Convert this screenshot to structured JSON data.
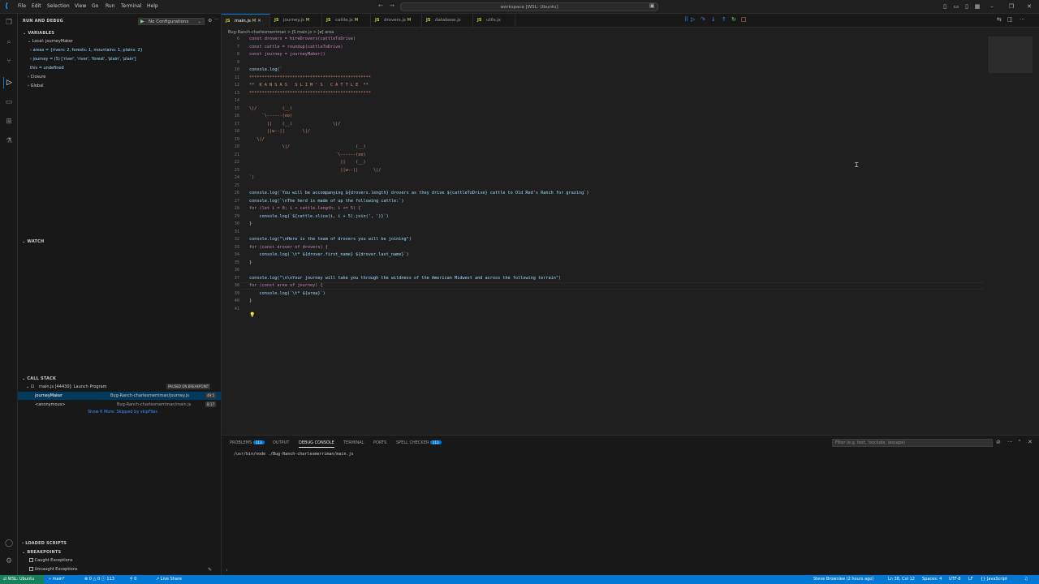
{
  "titlebar": {
    "menu": [
      "File",
      "Edit",
      "Selection",
      "View",
      "Go",
      "Run",
      "Terminal",
      "Help"
    ],
    "search": "workspace [WSL: Ubuntu]"
  },
  "sidebar": {
    "run_debug_title": "RUN AND DEBUG",
    "debug_config": "No Configurations",
    "variables_title": "VARIABLES",
    "local_scope": "Local: journeyMaker",
    "vars": [
      "› areas = {rivers: 2, forests: 1, mountains: 1, plains: 2}",
      "› journey = (5) ['river', 'river', 'forest', 'plain', 'plain']",
      "  this = undefined"
    ],
    "scopes": [
      "Closure",
      "Global"
    ],
    "watch_title": "WATCH",
    "callstack_title": "CALL STACK",
    "callstack_session": "main.js [44430]: Launch Program",
    "paused_label": "PAUSED ON BREAKPOINT",
    "frames": [
      {
        "name": "journeyMaker",
        "file": "Bug-Ranch-charlesmerriman/journey.js",
        "line": "49:5"
      },
      {
        "name": "<anonymous>",
        "file": "Bug-Ranch-charlesmerriman/main.js",
        "line": "8:17"
      }
    ],
    "show_more": "Show 6 More: Skipped by skipFiles",
    "loaded_scripts_title": "LOADED SCRIPTS",
    "breakpoints_title": "BREAKPOINTS",
    "breakpoints": [
      "Caught Exceptions",
      "Uncaught Exceptions"
    ]
  },
  "tabs": [
    {
      "label": "main.js",
      "mod": "M",
      "active": true
    },
    {
      "label": "journey.js",
      "mod": "M",
      "active": false
    },
    {
      "label": "cattle.js",
      "mod": "M",
      "active": false
    },
    {
      "label": "drovers.js",
      "mod": "M",
      "active": false
    },
    {
      "label": "database.js",
      "mod": "",
      "active": false
    },
    {
      "label": "utils.js",
      "mod": "",
      "active": false
    }
  ],
  "breadcrumb": "Bug-Ranch-charlesmerriman  >  JS main.js  >  [ø] area",
  "code_lines": [
    {
      "n": "6",
      "t": "const drovers = hireDrovers(cattleToDrive)"
    },
    {
      "n": "7",
      "t": "const cattle = roundup(cattleToDrive)"
    },
    {
      "n": "8",
      "t": "const journey = journeyMaker()"
    },
    {
      "n": "9",
      "t": ""
    },
    {
      "n": "10",
      "t": "console.log(`"
    },
    {
      "n": "11",
      "t": "************************************************"
    },
    {
      "n": "12",
      "t": "**  K A N S A S   S L I M ' S   C A T T L E  **"
    },
    {
      "n": "13",
      "t": "************************************************"
    },
    {
      "n": "14",
      "t": ""
    },
    {
      "n": "15",
      "t": "\\|/          (__)"
    },
    {
      "n": "16",
      "t": "     `\\------(oo)"
    },
    {
      "n": "17",
      "t": "       ||    (__)                \\|/"
    },
    {
      "n": "18",
      "t": "       ||w--||       \\|/"
    },
    {
      "n": "19",
      "t": "   \\|/"
    },
    {
      "n": "20",
      "t": "             \\|/                          (__)"
    },
    {
      "n": "21",
      "t": "                                  `\\------(oo)"
    },
    {
      "n": "22",
      "t": "                                    ||    (__)"
    },
    {
      "n": "23",
      "t": "                                    ||w--||      \\|/"
    },
    {
      "n": "24",
      "t": "`)"
    },
    {
      "n": "25",
      "t": ""
    },
    {
      "n": "26",
      "t": "console.log(`You will be accompanying ${drovers.length} drovers as they drive ${cattleToDrive} cattle to Old Red's Ranch for grazing`)"
    },
    {
      "n": "27",
      "t": "console.log(`\\nThe herd is made of up the following cattle:`)"
    },
    {
      "n": "28",
      "t": "for (let i = 0; i < cattle.length; i += 5) {"
    },
    {
      "n": "29",
      "t": "    console.log(`${cattle.slice(i, i + 5).join(', ')}`)"
    },
    {
      "n": "30",
      "t": "}"
    },
    {
      "n": "31",
      "t": ""
    },
    {
      "n": "32",
      "t": "console.log(\"\\nHere is the team of drovers you will be joining\")"
    },
    {
      "n": "33",
      "t": "for (const drover of drovers) {"
    },
    {
      "n": "34",
      "t": "    console.log(`\\t* ${drover.first_name} ${drover.last_name}`)"
    },
    {
      "n": "35",
      "t": "}"
    },
    {
      "n": "36",
      "t": ""
    },
    {
      "n": "37",
      "t": "console.log(\"\\n\\nYour journey will take you through the wildness of the American Midwest and across the following terrain\")"
    },
    {
      "n": "38",
      "t": "for (const area of journey) {"
    },
    {
      "n": "39",
      "t": "    console.log(`\\t* ${area}`)"
    },
    {
      "n": "40",
      "t": "}"
    },
    {
      "n": "41",
      "t": ""
    }
  ],
  "panel": {
    "tabs": [
      "PROBLEMS",
      "OUTPUT",
      "DEBUG CONSOLE",
      "TERMINAL",
      "PORTS",
      "SPELL CHECKER"
    ],
    "problems_count": "113",
    "spell_count": "113",
    "filter_placeholder": "Filter (e.g. text, !exclude, \\escape)",
    "console_line": "/usr/bin/node ./Bug-Ranch-charlesmerriman/main.js"
  },
  "statusbar": {
    "remote": "WSL: Ubuntu",
    "branch": "main*",
    "problems": "⊗ 0 △ 0 ⓘ 113",
    "ports": "⚲ 0",
    "live_share": "Live Share",
    "blame": "Steve Brownlee (2 hours ago)",
    "position": "Ln 38, Col 12",
    "spaces": "Spaces: 4",
    "encoding": "UTF-8",
    "eol": "LF",
    "language": "{} JavaScript"
  },
  "colors": {
    "accent": "#0078d4",
    "remote": "#16825d"
  }
}
